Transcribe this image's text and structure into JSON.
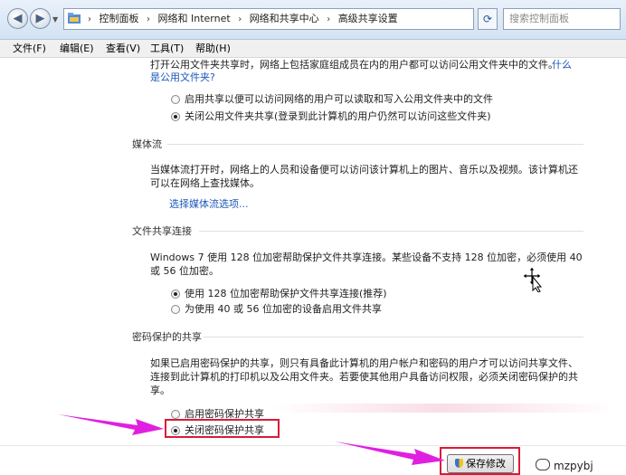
{
  "address": {
    "back": "◀",
    "forward": "▶",
    "breadcrumbs": [
      "控制面板",
      "网络和 Internet",
      "网络和共享中心",
      "高级共享设置"
    ],
    "search_placeholder": "搜索控制面板"
  },
  "menu": [
    "文件(F)",
    "编辑(E)",
    "查看(V)",
    "工具(T)",
    "帮助(H)"
  ],
  "public_folder": {
    "description_part1": "打开公用文件夹共享时，网络上包括家庭组成员在内的用户都可以访问公用文件夹中的文件。",
    "link": "什么",
    "link_line2": "是公用文件夹?",
    "options": [
      {
        "label": "启用共享以便可以访问网络的用户可以读取和写入公用文件夹中的文件",
        "selected": false
      },
      {
        "label": "关闭公用文件夹共享(登录到此计算机的用户仍然可以访问这些文件夹)",
        "selected": true
      }
    ]
  },
  "media": {
    "heading": "媒体流",
    "line1": "当媒体流打开时，网络上的人员和设备便可以访问该计算机上的图片、音乐以及视频。该计算机还",
    "line2": "可以在网络上查找媒体。",
    "link": "选择媒体流选项..."
  },
  "file_sharing": {
    "heading": "文件共享连接",
    "line1": "Windows 7 使用 128 位加密帮助保护文件共享连接。某些设备不支持 128 位加密，必须使用 40",
    "line2": "或 56 位加密。",
    "options": [
      {
        "label": "使用 128 位加密帮助保护文件共享连接(推荐)",
        "selected": true
      },
      {
        "label": "为使用 40 或 56 位加密的设备启用文件共享",
        "selected": false
      }
    ]
  },
  "password": {
    "heading": "密码保护的共享",
    "line1": "如果已启用密码保护的共享，则只有具备此计算机的用户帐户和密码的用户才可以访问共享文件、",
    "line2": "连接到此计算机的打印机以及公用文件夹。若要使其他用户具备访问权限，必须关闭密码保护的共",
    "line3": "享。",
    "options": [
      {
        "label": "启用密码保护共享",
        "selected": false
      },
      {
        "label": "关闭密码保护共享",
        "selected": true
      }
    ]
  },
  "save_label": "保存修改",
  "watermark": "mzpybj",
  "colors": {
    "highlight_red": "#d81b3a",
    "annotation_arrow": "#e020e0",
    "link": "#1c58b8"
  }
}
